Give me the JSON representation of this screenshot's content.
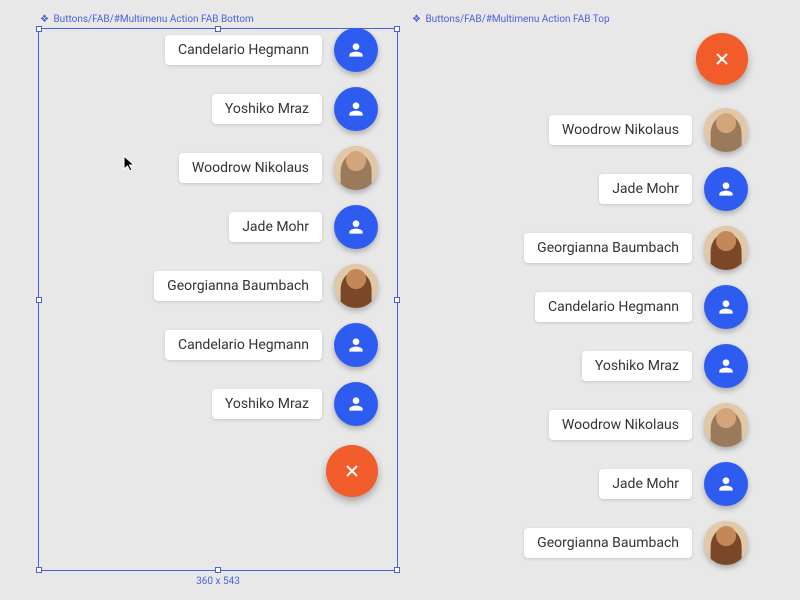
{
  "leftPanel": {
    "label": "Buttons/FAB/#Multimenu Action FAB Bottom",
    "dimensions": "360 x 543",
    "items": [
      {
        "name": "Candelario Hegmann",
        "type": "person"
      },
      {
        "name": "Yoshiko Mraz",
        "type": "person"
      },
      {
        "name": "Woodrow Nikolaus",
        "type": "avatar",
        "variant": "grey"
      },
      {
        "name": "Jade Mohr",
        "type": "person"
      },
      {
        "name": "Georgianna Baumbach",
        "type": "avatar",
        "variant": "orange"
      },
      {
        "name": "Candelario Hegmann",
        "type": "person"
      },
      {
        "name": "Yoshiko Mraz",
        "type": "person"
      }
    ]
  },
  "rightPanel": {
    "label": "Buttons/FAB/#Multimenu Action FAB Top",
    "items": [
      {
        "name": "Woodrow Nikolaus",
        "type": "avatar",
        "variant": "grey"
      },
      {
        "name": "Jade Mohr",
        "type": "person"
      },
      {
        "name": "Georgianna Baumbach",
        "type": "avatar",
        "variant": "orange"
      },
      {
        "name": "Candelario Hegmann",
        "type": "person"
      },
      {
        "name": "Yoshiko Mraz",
        "type": "person"
      },
      {
        "name": "Woodrow Nikolaus",
        "type": "avatar",
        "variant": "grey"
      },
      {
        "name": "Jade Mohr",
        "type": "person"
      },
      {
        "name": "Georgianna Baumbach",
        "type": "avatar",
        "variant": "orange"
      }
    ]
  },
  "colors": {
    "blue": "#2e5cf0",
    "orange": "#f25b2a",
    "selection": "#4a5fd8"
  }
}
